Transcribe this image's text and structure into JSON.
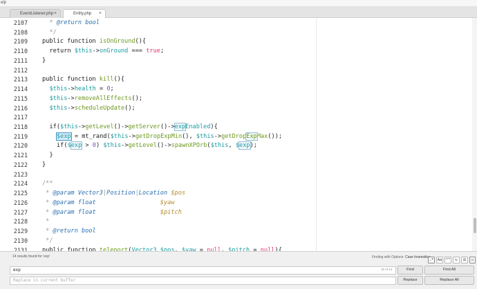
{
  "window": {
    "title": "elp"
  },
  "tabs": [
    {
      "label": "EventListener.php",
      "active": false,
      "close_icon": "×"
    },
    {
      "label": "Entity.php",
      "active": true,
      "close_icon": "×"
    }
  ],
  "editor": {
    "lines": [
      {
        "n": "2107",
        "ind": 1,
        "seg": [
          [
            "c",
            "* "
          ],
          [
            "ct",
            "@return"
          ],
          [
            "c",
            " "
          ],
          [
            "kt",
            "bool"
          ]
        ]
      },
      {
        "n": "2108",
        "ind": 1,
        "seg": [
          [
            "c",
            "*/"
          ]
        ]
      },
      {
        "n": "2109",
        "ind": 0,
        "seg": [
          [
            "",
            "public function "
          ],
          [
            "f",
            "isOnGround"
          ],
          [
            "",
            "(){"
          ]
        ]
      },
      {
        "n": "2110",
        "ind": 1,
        "seg": [
          [
            "",
            "return "
          ],
          [
            "p",
            "$this"
          ],
          [
            "",
            "->"
          ],
          [
            "p",
            "onGround"
          ],
          [
            "",
            " === "
          ],
          [
            "k",
            "true"
          ],
          [
            "",
            ";"
          ]
        ]
      },
      {
        "n": "2111",
        "ind": 0,
        "seg": [
          [
            "",
            "}"
          ]
        ]
      },
      {
        "n": "2112",
        "ind": 0,
        "seg": []
      },
      {
        "n": "2113",
        "ind": 0,
        "seg": [
          [
            "",
            "public function "
          ],
          [
            "f",
            "kill"
          ],
          [
            "",
            "(){"
          ]
        ]
      },
      {
        "n": "2114",
        "ind": 1,
        "seg": [
          [
            "p",
            "$this"
          ],
          [
            "",
            "->"
          ],
          [
            "p",
            "health"
          ],
          [
            "",
            " = "
          ],
          [
            "n",
            "0"
          ],
          [
            "",
            ";"
          ]
        ]
      },
      {
        "n": "2115",
        "ind": 1,
        "seg": [
          [
            "p",
            "$this"
          ],
          [
            "",
            "->"
          ],
          [
            "f",
            "removeAllEffects"
          ],
          [
            "",
            "();"
          ]
        ]
      },
      {
        "n": "2116",
        "ind": 1,
        "seg": [
          [
            "p",
            "$this"
          ],
          [
            "",
            "->"
          ],
          [
            "f",
            "scheduleUpdate"
          ],
          [
            "",
            "();"
          ]
        ]
      },
      {
        "n": "2117",
        "ind": 0,
        "seg": []
      },
      {
        "n": "2118",
        "ind": 1,
        "seg": [
          [
            "",
            "if("
          ],
          [
            "p",
            "$this"
          ],
          [
            "",
            "->"
          ],
          [
            "f",
            "getLevel"
          ],
          [
            "",
            "()->"
          ],
          [
            "f",
            "getServer"
          ],
          [
            "",
            "()->"
          ],
          [
            "pf",
            "exp"
          ],
          [
            "p",
            "Enabled"
          ],
          [
            "",
            "){"
          ]
        ]
      },
      {
        "n": "2119",
        "ind": 2,
        "seg": [
          [
            "pc",
            "$exp"
          ],
          [
            "",
            " = mt_rand("
          ],
          [
            "p",
            "$this"
          ],
          [
            "",
            "->"
          ],
          [
            "f",
            "getDropExpMin"
          ],
          [
            "",
            "(), "
          ],
          [
            "p",
            "$this"
          ],
          [
            "",
            "->"
          ],
          [
            "f",
            "getDrop"
          ],
          [
            "ff",
            "Exp"
          ],
          [
            "f",
            "Max"
          ],
          [
            "",
            "());"
          ]
        ]
      },
      {
        "n": "2120",
        "ind": 2,
        "seg": [
          [
            "",
            "if("
          ],
          [
            "p",
            "$"
          ],
          [
            "pf",
            "exp"
          ],
          [
            "",
            " > "
          ],
          [
            "n",
            "0"
          ],
          [
            "",
            ") "
          ],
          [
            "p",
            "$this"
          ],
          [
            "",
            "->"
          ],
          [
            "f",
            "getLevel"
          ],
          [
            "",
            "()->"
          ],
          [
            "f",
            "spawnXPOrb"
          ],
          [
            "",
            "("
          ],
          [
            "p",
            "$this"
          ],
          [
            "",
            ", "
          ],
          [
            "p",
            "$"
          ],
          [
            "pf",
            "exp"
          ],
          [
            "",
            ");"
          ]
        ]
      },
      {
        "n": "2121",
        "ind": 1,
        "seg": [
          [
            "",
            "}"
          ]
        ]
      },
      {
        "n": "2122",
        "ind": 0,
        "seg": [
          [
            "",
            "}"
          ]
        ]
      },
      {
        "n": "2123",
        "ind": 0,
        "seg": []
      },
      {
        "n": "2124",
        "ind": 0,
        "seg": [
          [
            "c",
            "/**"
          ]
        ]
      },
      {
        "n": "2125",
        "ind": 0,
        "seg": [
          [
            "c",
            " * "
          ],
          [
            "ct",
            "@param"
          ],
          [
            "c",
            " "
          ],
          [
            "kt",
            "Vector3"
          ],
          [
            "c",
            "|"
          ],
          [
            "kt",
            "Position"
          ],
          [
            "c",
            "|"
          ],
          [
            "kt",
            "Location"
          ],
          [
            "c",
            " "
          ],
          [
            "cv",
            "$pos"
          ]
        ]
      },
      {
        "n": "2126",
        "ind": 0,
        "seg": [
          [
            "c",
            " * "
          ],
          [
            "ct",
            "@param"
          ],
          [
            "c",
            " "
          ],
          [
            "kt",
            "float"
          ],
          [
            "c",
            "                  "
          ],
          [
            "cv",
            "$yaw"
          ]
        ]
      },
      {
        "n": "2127",
        "ind": 0,
        "seg": [
          [
            "c",
            " * "
          ],
          [
            "ct",
            "@param"
          ],
          [
            "c",
            " "
          ],
          [
            "kt",
            "float"
          ],
          [
            "c",
            "                  "
          ],
          [
            "cv",
            "$pitch"
          ]
        ]
      },
      {
        "n": "2128",
        "ind": 0,
        "seg": [
          [
            "c",
            " *"
          ]
        ]
      },
      {
        "n": "2129",
        "ind": 0,
        "seg": [
          [
            "c",
            " * "
          ],
          [
            "ct",
            "@return"
          ],
          [
            "c",
            " "
          ],
          [
            "kt",
            "bool"
          ]
        ]
      },
      {
        "n": "2130",
        "ind": 0,
        "seg": [
          [
            "c",
            " */"
          ]
        ]
      },
      {
        "n": "2131",
        "ind": 0,
        "seg": [
          [
            "",
            "public function "
          ],
          [
            "f",
            "teleport"
          ],
          [
            "",
            "("
          ],
          [
            "p",
            "Vector3"
          ],
          [
            "",
            " "
          ],
          [
            "p",
            "$pos"
          ],
          [
            "",
            ", "
          ],
          [
            "p",
            "$yaw"
          ],
          [
            "",
            " = "
          ],
          [
            "k",
            "null"
          ],
          [
            "",
            ", "
          ],
          [
            "p",
            "$pitch"
          ],
          [
            "",
            " = "
          ],
          [
            "k",
            "null"
          ],
          [
            "",
            "){"
          ]
        ]
      }
    ]
  },
  "find_panel": {
    "status": "14 results found for 'exp'",
    "options_label": "Finding with Options:",
    "options_value": "Case Insensitive",
    "option_toggles": [
      {
        "name": "regex-toggle",
        "glyph": ".*",
        "on": true
      },
      {
        "name": "case-toggle",
        "glyph": "Aa",
        "on": false
      },
      {
        "name": "whole-word-toggle",
        "glyph": "“”",
        "on": false
      },
      {
        "name": "wrap-toggle",
        "glyph": "↻",
        "on": false
      },
      {
        "name": "in-selection-toggle",
        "glyph": "☰",
        "on": false
      },
      {
        "name": "highlight-toggle",
        "glyph": "▭",
        "on": true
      }
    ],
    "find_value": "exp",
    "counter": "10 of 14",
    "replace_placeholder": "Replace in current buffer",
    "find_label": "Find",
    "find_all_label": "Find All",
    "replace_label": "Replace",
    "replace_all_label": "Replace All"
  }
}
